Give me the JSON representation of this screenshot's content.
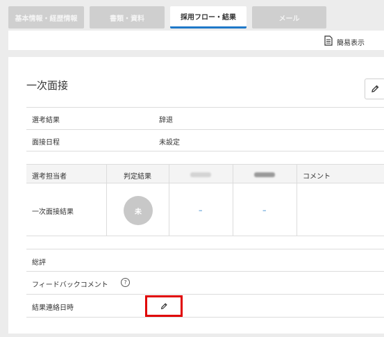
{
  "tabs": [
    {
      "label": "基本情報・経歴情報"
    },
    {
      "label": "書類・資料"
    },
    {
      "label": "採用フロー・結果"
    },
    {
      "label": "メール"
    }
  ],
  "toolbar": {
    "simple_view_label": "簡易表示"
  },
  "section": {
    "title": "一次面接",
    "fields": [
      {
        "label": "選考結果",
        "value": "辞退"
      },
      {
        "label": "面接日程",
        "value": "未設定"
      }
    ],
    "evaluation_table": {
      "headers": [
        "選考担当者",
        "判定結果",
        "",
        "",
        "コメント"
      ],
      "row": {
        "label": "一次面接結果",
        "judgment_badge": "未",
        "evaluator1": "–",
        "evaluator2": "–",
        "comment": ""
      }
    },
    "summary_label": "総評",
    "feedback_label": "フィードバックコメント",
    "help_glyph": "?",
    "result_contact_label": "結果連絡日時"
  },
  "colors": {
    "accent": "#1e78c8",
    "highlight": "#e00000",
    "tab_inactive": "#cfcfcf"
  },
  "icons": [
    "document-icon",
    "pencil-icon",
    "help-circle-icon"
  ]
}
